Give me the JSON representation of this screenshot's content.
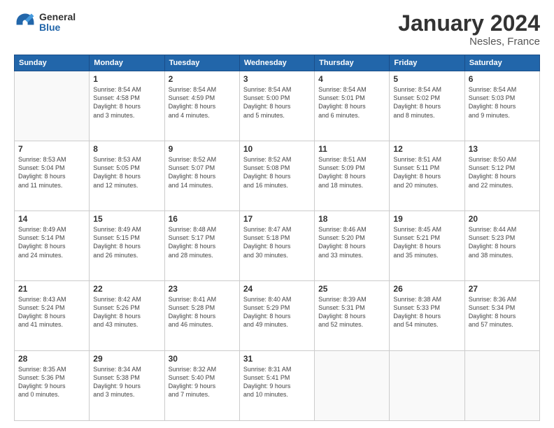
{
  "header": {
    "logo": {
      "general": "General",
      "blue": "Blue"
    },
    "title": "January 2024",
    "location": "Nesles, France"
  },
  "days_of_week": [
    "Sunday",
    "Monday",
    "Tuesday",
    "Wednesday",
    "Thursday",
    "Friday",
    "Saturday"
  ],
  "weeks": [
    [
      {
        "day": "",
        "info": ""
      },
      {
        "day": "1",
        "info": "Sunrise: 8:54 AM\nSunset: 4:58 PM\nDaylight: 8 hours\nand 3 minutes."
      },
      {
        "day": "2",
        "info": "Sunrise: 8:54 AM\nSunset: 4:59 PM\nDaylight: 8 hours\nand 4 minutes."
      },
      {
        "day": "3",
        "info": "Sunrise: 8:54 AM\nSunset: 5:00 PM\nDaylight: 8 hours\nand 5 minutes."
      },
      {
        "day": "4",
        "info": "Sunrise: 8:54 AM\nSunset: 5:01 PM\nDaylight: 8 hours\nand 6 minutes."
      },
      {
        "day": "5",
        "info": "Sunrise: 8:54 AM\nSunset: 5:02 PM\nDaylight: 8 hours\nand 8 minutes."
      },
      {
        "day": "6",
        "info": "Sunrise: 8:54 AM\nSunset: 5:03 PM\nDaylight: 8 hours\nand 9 minutes."
      }
    ],
    [
      {
        "day": "7",
        "info": "Sunrise: 8:53 AM\nSunset: 5:04 PM\nDaylight: 8 hours\nand 11 minutes."
      },
      {
        "day": "8",
        "info": "Sunrise: 8:53 AM\nSunset: 5:05 PM\nDaylight: 8 hours\nand 12 minutes."
      },
      {
        "day": "9",
        "info": "Sunrise: 8:52 AM\nSunset: 5:07 PM\nDaylight: 8 hours\nand 14 minutes."
      },
      {
        "day": "10",
        "info": "Sunrise: 8:52 AM\nSunset: 5:08 PM\nDaylight: 8 hours\nand 16 minutes."
      },
      {
        "day": "11",
        "info": "Sunrise: 8:51 AM\nSunset: 5:09 PM\nDaylight: 8 hours\nand 18 minutes."
      },
      {
        "day": "12",
        "info": "Sunrise: 8:51 AM\nSunset: 5:11 PM\nDaylight: 8 hours\nand 20 minutes."
      },
      {
        "day": "13",
        "info": "Sunrise: 8:50 AM\nSunset: 5:12 PM\nDaylight: 8 hours\nand 22 minutes."
      }
    ],
    [
      {
        "day": "14",
        "info": "Sunrise: 8:49 AM\nSunset: 5:14 PM\nDaylight: 8 hours\nand 24 minutes."
      },
      {
        "day": "15",
        "info": "Sunrise: 8:49 AM\nSunset: 5:15 PM\nDaylight: 8 hours\nand 26 minutes."
      },
      {
        "day": "16",
        "info": "Sunrise: 8:48 AM\nSunset: 5:17 PM\nDaylight: 8 hours\nand 28 minutes."
      },
      {
        "day": "17",
        "info": "Sunrise: 8:47 AM\nSunset: 5:18 PM\nDaylight: 8 hours\nand 30 minutes."
      },
      {
        "day": "18",
        "info": "Sunrise: 8:46 AM\nSunset: 5:20 PM\nDaylight: 8 hours\nand 33 minutes."
      },
      {
        "day": "19",
        "info": "Sunrise: 8:45 AM\nSunset: 5:21 PM\nDaylight: 8 hours\nand 35 minutes."
      },
      {
        "day": "20",
        "info": "Sunrise: 8:44 AM\nSunset: 5:23 PM\nDaylight: 8 hours\nand 38 minutes."
      }
    ],
    [
      {
        "day": "21",
        "info": "Sunrise: 8:43 AM\nSunset: 5:24 PM\nDaylight: 8 hours\nand 41 minutes."
      },
      {
        "day": "22",
        "info": "Sunrise: 8:42 AM\nSunset: 5:26 PM\nDaylight: 8 hours\nand 43 minutes."
      },
      {
        "day": "23",
        "info": "Sunrise: 8:41 AM\nSunset: 5:28 PM\nDaylight: 8 hours\nand 46 minutes."
      },
      {
        "day": "24",
        "info": "Sunrise: 8:40 AM\nSunset: 5:29 PM\nDaylight: 8 hours\nand 49 minutes."
      },
      {
        "day": "25",
        "info": "Sunrise: 8:39 AM\nSunset: 5:31 PM\nDaylight: 8 hours\nand 52 minutes."
      },
      {
        "day": "26",
        "info": "Sunrise: 8:38 AM\nSunset: 5:33 PM\nDaylight: 8 hours\nand 54 minutes."
      },
      {
        "day": "27",
        "info": "Sunrise: 8:36 AM\nSunset: 5:34 PM\nDaylight: 8 hours\nand 57 minutes."
      }
    ],
    [
      {
        "day": "28",
        "info": "Sunrise: 8:35 AM\nSunset: 5:36 PM\nDaylight: 9 hours\nand 0 minutes."
      },
      {
        "day": "29",
        "info": "Sunrise: 8:34 AM\nSunset: 5:38 PM\nDaylight: 9 hours\nand 3 minutes."
      },
      {
        "day": "30",
        "info": "Sunrise: 8:32 AM\nSunset: 5:40 PM\nDaylight: 9 hours\nand 7 minutes."
      },
      {
        "day": "31",
        "info": "Sunrise: 8:31 AM\nSunset: 5:41 PM\nDaylight: 9 hours\nand 10 minutes."
      },
      {
        "day": "",
        "info": ""
      },
      {
        "day": "",
        "info": ""
      },
      {
        "day": "",
        "info": ""
      }
    ]
  ]
}
